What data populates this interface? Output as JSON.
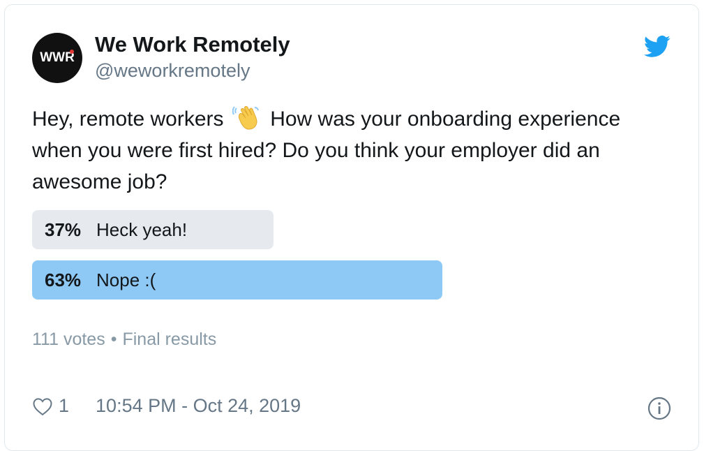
{
  "account": {
    "avatar_text": "WWR",
    "display_name": "We Work Remotely",
    "handle": "@weworkremotely"
  },
  "tweet": {
    "text_before": "Hey, remote workers",
    "text_after": "How was your onboarding experience when you were first hired? Do you think your employer did an awesome job?",
    "emoji": "waving-hand-icon"
  },
  "poll": {
    "options": [
      {
        "percent_label": "37%",
        "percent": 37,
        "label": "Heck yeah!",
        "winner": false
      },
      {
        "percent_label": "63%",
        "percent": 63,
        "label": "Nope :(",
        "winner": true
      }
    ],
    "votes": "111 votes",
    "separator": "•",
    "status": "Final results"
  },
  "footer": {
    "likes": "1",
    "timestamp": "10:54 PM - Oct 24, 2019"
  },
  "colors": {
    "winner_bar": "#8ec9f5",
    "loser_bar": "#e6e9ee",
    "twitter_blue": "#1da1f2",
    "secondary_text": "#657786"
  }
}
